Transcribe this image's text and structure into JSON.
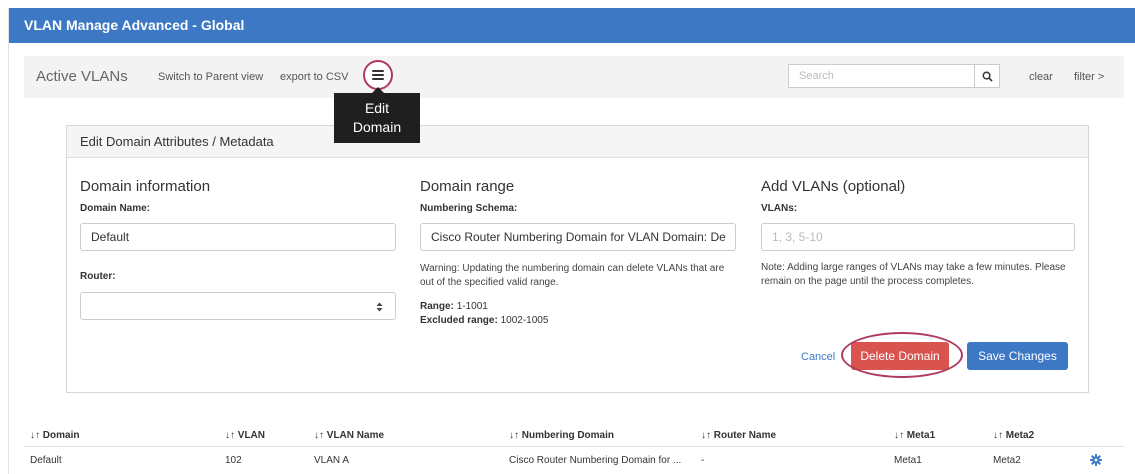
{
  "window": {
    "title": "VLAN Manage Advanced - Global"
  },
  "toolbar": {
    "title": "Active VLANs",
    "switch_label": "Switch to Parent view",
    "export_label": "export to CSV",
    "menu_icon": "hamburger-icon",
    "tooltip_line1": "Edit",
    "tooltip_line2": "Domain",
    "search_placeholder": "Search",
    "clear_label": "clear",
    "filter_label": "filter >"
  },
  "panel": {
    "header": "Edit Domain Attributes / Metadata",
    "domain_info": {
      "heading": "Domain information",
      "name_label": "Domain Name:",
      "name_value": "Default",
      "router_label": "Router:",
      "router_value": ""
    },
    "domain_range": {
      "heading": "Domain range",
      "schema_label": "Numbering Schema:",
      "schema_value": "Cisco Router Numbering Domain for VLAN Domain: De",
      "warning": "Warning: Updating the numbering domain can delete VLANs that are out of the specified valid range.",
      "range_label": "Range:",
      "range_value": "1-1001",
      "excluded_label": "Excluded range:",
      "excluded_value": "1002-1005"
    },
    "add_vlans": {
      "heading": "Add VLANs (optional)",
      "vlans_label": "VLANs:",
      "vlans_placeholder": "1, 3, 5-10",
      "note": "Note: Adding large ranges of VLANs may take a few minutes. Please remain on the page until the process completes."
    },
    "actions": {
      "cancel": "Cancel",
      "delete": "Delete Domain",
      "save": "Save Changes"
    }
  },
  "table": {
    "sort_glyph": "↓↑",
    "headers": [
      "Domain",
      "VLAN",
      "VLAN Name",
      "Numbering Domain",
      "Router Name",
      "Meta1",
      "Meta2"
    ],
    "rows": [
      [
        "Default",
        "102",
        "VLAN A",
        "Cisco Router Numbering Domain for ...",
        "-",
        "Meta1",
        "Meta2"
      ]
    ]
  },
  "colors": {
    "title_bar": "#3c78c3",
    "delete": "#d9534f",
    "save": "#3c78c3",
    "highlight_ring": "#b03a5e"
  }
}
